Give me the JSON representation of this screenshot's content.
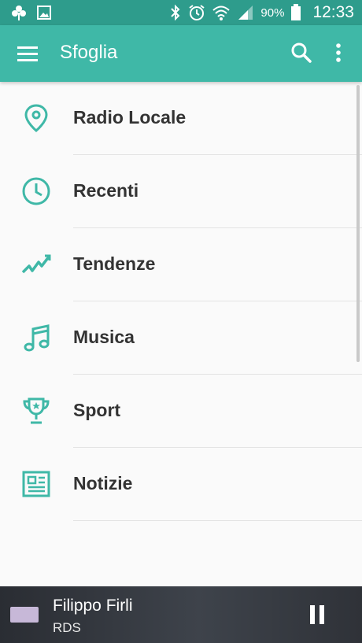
{
  "status_bar": {
    "left_icons": [
      "pinwheel-icon",
      "image-icon"
    ],
    "right_icons": [
      "bluetooth-icon",
      "alarm-icon",
      "wifi-icon",
      "signal-icon",
      "battery-icon"
    ],
    "battery": "90%",
    "time": "12:33"
  },
  "app_bar": {
    "title": "Sfoglia",
    "accent_color": "#3fb8a7"
  },
  "menu": {
    "items": [
      {
        "label": "Radio Locale",
        "icon": "location-pin-icon"
      },
      {
        "label": "Recenti",
        "icon": "clock-icon"
      },
      {
        "label": "Tendenze",
        "icon": "trending-icon"
      },
      {
        "label": "Musica",
        "icon": "music-note-icon"
      },
      {
        "label": "Sport",
        "icon": "trophy-icon"
      },
      {
        "label": "Notizie",
        "icon": "newspaper-icon"
      }
    ]
  },
  "player": {
    "track": "Filippo Firli",
    "station": "RDS",
    "state_icon": "pause-icon"
  }
}
